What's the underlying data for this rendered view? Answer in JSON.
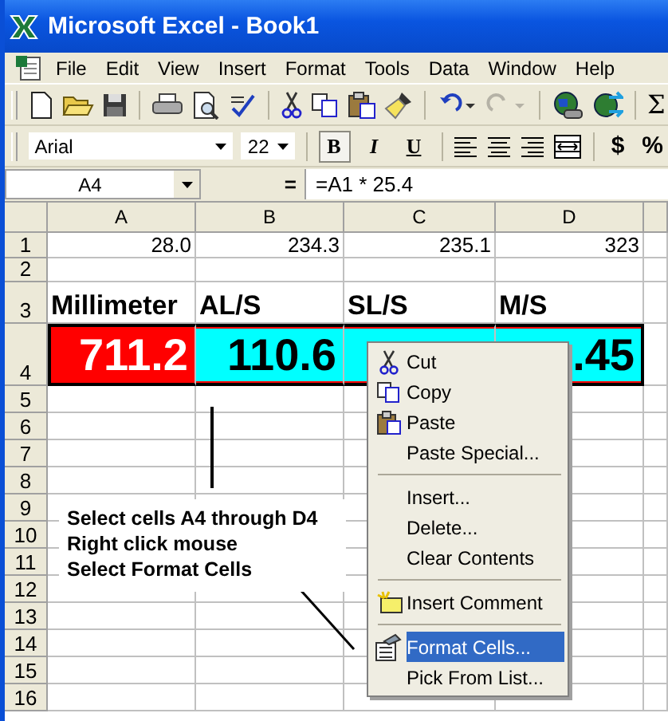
{
  "window": {
    "title": "Microsoft Excel - Book1"
  },
  "menu": [
    {
      "label": "File"
    },
    {
      "label": "Edit"
    },
    {
      "label": "View"
    },
    {
      "label": "Insert"
    },
    {
      "label": "Format"
    },
    {
      "label": "Tools"
    },
    {
      "label": "Data"
    },
    {
      "label": "Window"
    },
    {
      "label": "Help"
    }
  ],
  "standard_toolbar": {
    "sum": "Σ",
    "redo_disabled": true
  },
  "formatting_toolbar": {
    "font": "Arial",
    "size": "22",
    "bold": "B",
    "bold_on": true,
    "italic": "I",
    "underline": "U",
    "currency": "$",
    "percent": "%"
  },
  "formula_bar": {
    "name_box": "A4",
    "equals": "=",
    "formula": "=A1 * 25.4"
  },
  "sheet": {
    "columns": [
      {
        "label": "A"
      },
      {
        "label": "B"
      },
      {
        "label": "C"
      },
      {
        "label": "D"
      }
    ],
    "rows": [
      {
        "header": "1",
        "cells": [
          {
            "kind": "number",
            "text": "28.0"
          },
          {
            "kind": "number",
            "text": "234.3"
          },
          {
            "kind": "number",
            "text": "235.1"
          },
          {
            "kind": "number",
            "text": "323"
          }
        ]
      },
      {
        "header": "2",
        "cells": []
      },
      {
        "header": "3",
        "cells": [
          {
            "kind": "heading",
            "text": "Millimeter"
          },
          {
            "kind": "heading",
            "text": "AL/S"
          },
          {
            "kind": "heading",
            "text": "SL/S"
          },
          {
            "kind": "heading",
            "text": "M/S"
          }
        ]
      },
      {
        "header": "4",
        "cells": [
          {
            "kind": "result",
            "text": "711.2",
            "color": "#ff0000",
            "selected": true
          },
          {
            "kind": "result",
            "text": "110.6",
            "color": "#00ffff",
            "selected": true
          },
          {
            "kind": "result",
            "color": "#00ffff",
            "selected": true
          },
          {
            "kind": "result",
            "text": ".45",
            "color": "#00ffff",
            "selected": true
          }
        ]
      },
      {
        "header": "5",
        "cells": []
      },
      {
        "header": "6",
        "cells": []
      },
      {
        "header": "7",
        "cells": []
      },
      {
        "header": "8",
        "cells": []
      },
      {
        "header": "9",
        "cells": []
      },
      {
        "header": "10",
        "cells": []
      },
      {
        "header": "11",
        "cells": []
      },
      {
        "header": "12",
        "cells": []
      },
      {
        "header": "13",
        "cells": []
      },
      {
        "header": "14",
        "cells": []
      },
      {
        "header": "15",
        "cells": []
      },
      {
        "header": "16",
        "cells": []
      }
    ]
  },
  "context_menu": [
    {
      "kind": "item",
      "label": "Cut",
      "selected": false
    },
    {
      "kind": "item",
      "label": "Copy",
      "selected": false
    },
    {
      "kind": "item",
      "label": "Paste",
      "selected": false
    },
    {
      "kind": "item",
      "label": "Paste Special...",
      "selected": false
    },
    {
      "kind": "separator"
    },
    {
      "kind": "item",
      "label": "Insert...",
      "selected": false
    },
    {
      "kind": "item",
      "label": "Delete...",
      "selected": false
    },
    {
      "kind": "item",
      "label": "Clear Contents",
      "selected": false
    },
    {
      "kind": "separator"
    },
    {
      "kind": "item",
      "label": "Insert Comment",
      "selected": false
    },
    {
      "kind": "separator"
    },
    {
      "kind": "item",
      "label": "Format Cells...",
      "selected": true
    },
    {
      "kind": "item",
      "label": "Pick From List...",
      "selected": false
    }
  ],
  "note": {
    "lines": [
      "Select cells A4 through D4",
      "Right click mouse",
      "Select Format Cells"
    ]
  }
}
